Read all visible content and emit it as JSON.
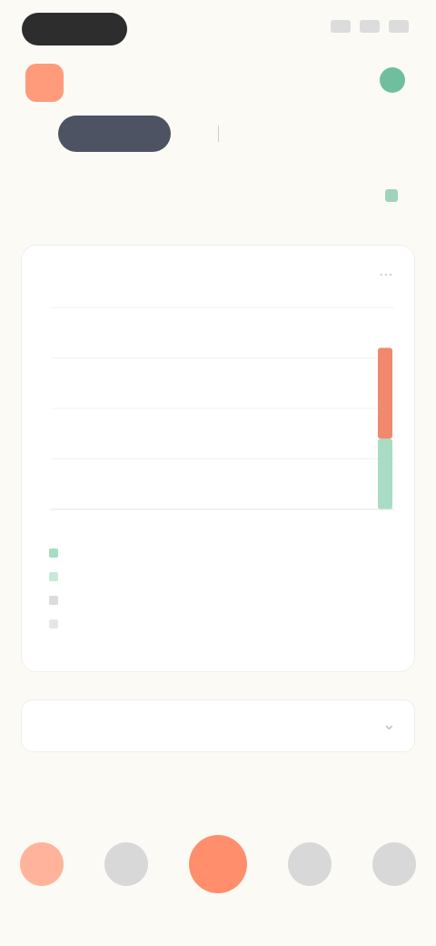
{
  "status_bar": {
    "time": "",
    "icons": [
      "signal-icon",
      "wifi-icon",
      "battery-icon"
    ]
  },
  "header": {
    "brand_logo": "",
    "brand_name": "",
    "action_label": ""
  },
  "tabs": [
    {
      "label": "",
      "active": false
    },
    {
      "label": "",
      "active": true
    },
    {
      "label": "",
      "active": false
    },
    {
      "label": "",
      "active": false
    }
  ],
  "stats": {
    "left": "",
    "right": ""
  },
  "chart": {
    "title": "",
    "footnote": "",
    "legend": [
      "",
      "",
      "",
      ""
    ]
  },
  "section": {
    "label": ""
  },
  "colors": {
    "background": "#fbfaf4",
    "accent_orange": "#ff8e6c",
    "accent_green": "#5fae86",
    "tab_active": "#4e5363",
    "bar_red": "#f08a6c",
    "bar_green": "#a8dcc4"
  },
  "chart_data": {
    "type": "bar",
    "categories": [],
    "series": [
      {
        "values": [
          45
        ]
      },
      {
        "values": [
          35
        ]
      }
    ],
    "ylim": [
      0,
      100
    ],
    "grid": true,
    "legend_position": "bottom-left"
  },
  "bottom_nav": {
    "items": [
      "home-icon",
      "list-icon",
      "add-icon",
      "chart-icon",
      "profile-icon"
    ]
  }
}
